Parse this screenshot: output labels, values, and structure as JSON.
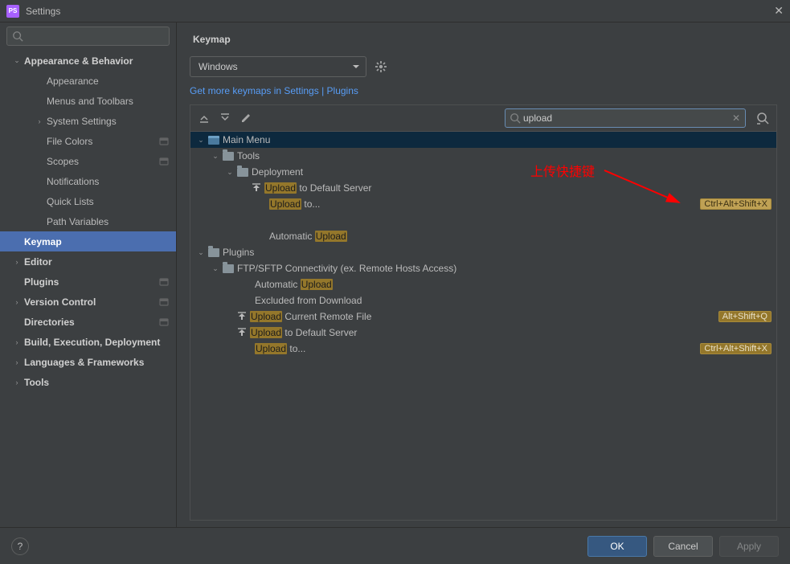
{
  "window": {
    "title": "Settings"
  },
  "sidebar": {
    "items": [
      {
        "label": "Appearance & Behavior",
        "bold": true,
        "expanded": true,
        "hasChevron": true,
        "ind": 0
      },
      {
        "label": "Appearance",
        "ind": 1
      },
      {
        "label": "Menus and Toolbars",
        "ind": 1
      },
      {
        "label": "System Settings",
        "hasChevron": true,
        "ind": 1
      },
      {
        "label": "File Colors",
        "tailIcon": true,
        "ind": 1
      },
      {
        "label": "Scopes",
        "tailIcon": true,
        "ind": 1
      },
      {
        "label": "Notifications",
        "ind": 1
      },
      {
        "label": "Quick Lists",
        "ind": 1
      },
      {
        "label": "Path Variables",
        "ind": 1
      },
      {
        "label": "Keymap",
        "bold": true,
        "selected": true,
        "ind": 0
      },
      {
        "label": "Editor",
        "bold": true,
        "hasChevron": true,
        "ind": 0
      },
      {
        "label": "Plugins",
        "bold": true,
        "tailIcon": true,
        "ind": 0
      },
      {
        "label": "Version Control",
        "bold": true,
        "hasChevron": true,
        "tailIcon": true,
        "ind": 0
      },
      {
        "label": "Directories",
        "bold": true,
        "tailIcon": true,
        "ind": 0
      },
      {
        "label": "Build, Execution, Deployment",
        "bold": true,
        "hasChevron": true,
        "ind": 0
      },
      {
        "label": "Languages & Frameworks",
        "bold": true,
        "hasChevron": true,
        "ind": 0
      },
      {
        "label": "Tools",
        "bold": true,
        "hasChevron": true,
        "ind": 0
      }
    ]
  },
  "main": {
    "title": "Keymap",
    "scheme": "Windows",
    "link1": "Get more keymaps in Settings",
    "linkSep": " | ",
    "link2": "Plugins",
    "search": "upload"
  },
  "rows": [
    {
      "pl": 1,
      "chev": "down",
      "icon": "menu",
      "pre": "",
      "hl": "",
      "post": "Main Menu",
      "sel": true
    },
    {
      "pl": 2,
      "chev": "down",
      "icon": "folder",
      "pre": "",
      "hl": "",
      "post": "Tools"
    },
    {
      "pl": 3,
      "chev": "down",
      "icon": "folder",
      "pre": "",
      "hl": "",
      "post": "Deployment"
    },
    {
      "pl": 4,
      "icon": "up",
      "pre": "",
      "hl": "Upload",
      "post": " to Default Server"
    },
    {
      "pl": 5,
      "pre": "",
      "hl": "Upload",
      "post": " to...",
      "shortcut": "Ctrl+Alt+Shift+X",
      "scB": true
    },
    {
      "pl": 5,
      "pre": "",
      "hl": "",
      "post": ""
    },
    {
      "pl": 5,
      "pre": "Automatic ",
      "hl": "Upload",
      "post": ""
    },
    {
      "pl": 1,
      "chev": "down",
      "icon": "folder",
      "pre": "",
      "hl": "",
      "post": "Plugins"
    },
    {
      "pl": 2,
      "chev": "down",
      "icon": "folder",
      "pre": "",
      "hl": "",
      "post": "FTP/SFTP Connectivity (ex. Remote Hosts Access)"
    },
    {
      "pl": 4,
      "pre": "Automatic ",
      "hl": "Upload",
      "post": ""
    },
    {
      "pl": 4,
      "pre": "",
      "hl": "",
      "post": "Excluded from Download"
    },
    {
      "pl": 3,
      "icon": "up",
      "pre": "",
      "hl": "Upload",
      "post": " Current Remote File",
      "shortcut": "Alt+Shift+Q"
    },
    {
      "pl": 3,
      "icon": "up",
      "pre": "",
      "hl": "Upload",
      "post": " to Default Server"
    },
    {
      "pl": 4,
      "pre": "",
      "hl": "Upload",
      "post": " to...",
      "shortcut": "Ctrl+Alt+Shift+X"
    }
  ],
  "annotation": {
    "text": "上传快捷键"
  },
  "footer": {
    "ok": "OK",
    "cancel": "Cancel",
    "apply": "Apply"
  }
}
